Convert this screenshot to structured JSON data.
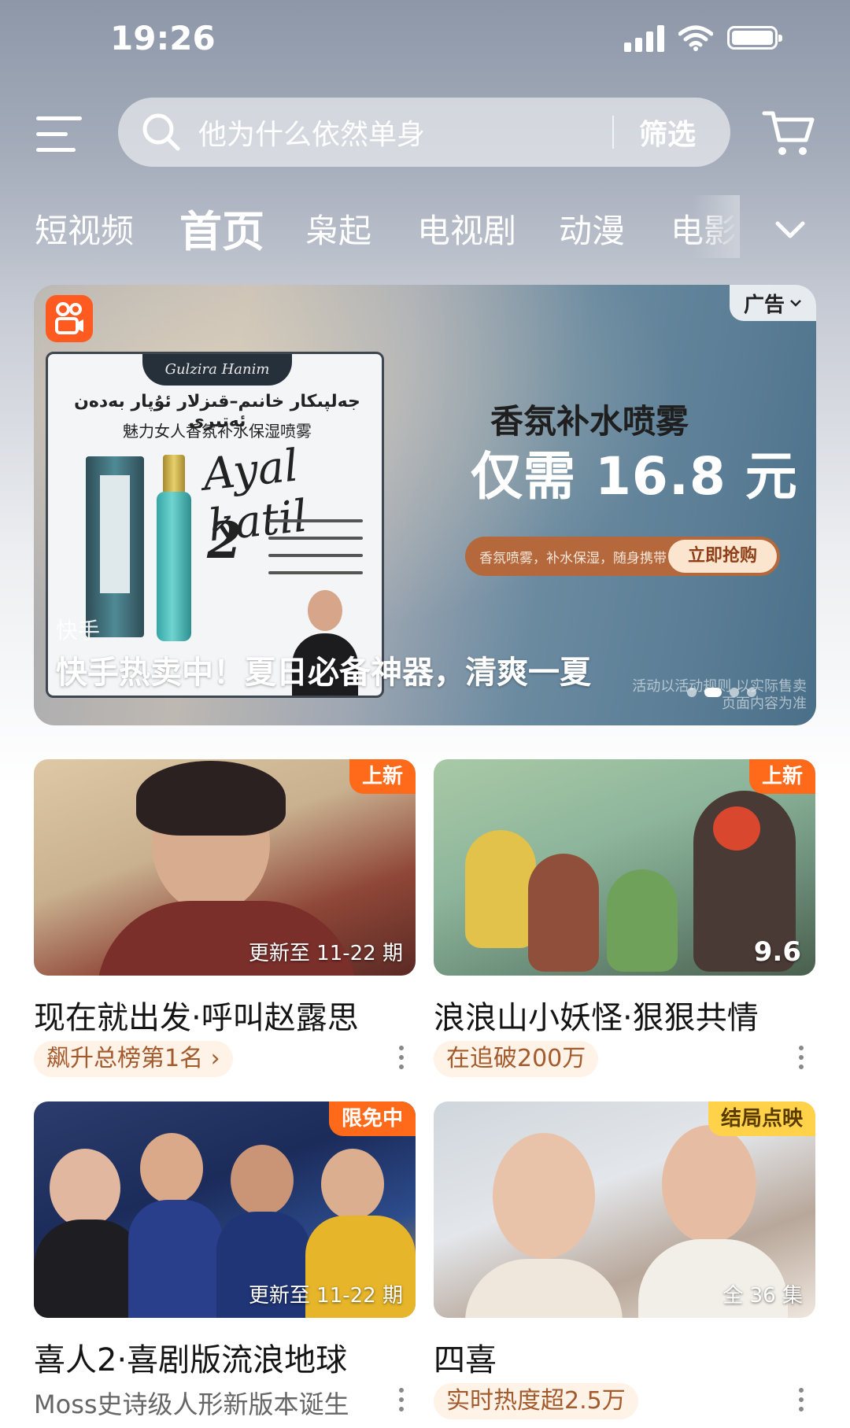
{
  "status_bar": {
    "time": "19:26"
  },
  "search": {
    "placeholder": "他为什么依然单身",
    "filter_label": "筛选"
  },
  "tabs": [
    {
      "label": "短视频"
    },
    {
      "label": "首页",
      "active": true
    },
    {
      "label": "枭起"
    },
    {
      "label": "电视剧"
    },
    {
      "label": "动漫"
    },
    {
      "label": "电影"
    }
  ],
  "banner": {
    "ad_label": "广告",
    "product_brand": "Gulzira Hanim",
    "product_uyghur": "جەلپىكار خانىم–قىزلار ئۇپار بەدەن ئەتىرى",
    "product_cn": "魅力女人香氛补水保湿喷雾",
    "product_script": "Ayal katil",
    "product_number": "2",
    "headline": "香氛补水喷雾",
    "price": "仅需 16.8 元",
    "pill_text": "香氛喷雾，补水保湿，随身携带！",
    "buy_label": "立即抢购",
    "source": "快手",
    "caption": "快手热卖中！夏日必备神器，清爽一夏",
    "disclaimer": "活动以活动规则 以实际售卖页面内容为准"
  },
  "cards": [
    {
      "title": "现在就出发·呼叫赵露思",
      "badge": "上新",
      "thumb_label": "更新至 11-22 期",
      "sub": "飙升总榜第1名 ›"
    },
    {
      "title": "浪浪山小妖怪·狠狠共情",
      "badge": "上新",
      "score": "9.6",
      "sub": "在追破200万"
    },
    {
      "title": "喜人2·喜剧版流浪地球",
      "badge": "限免中",
      "thumb_label": "更新至 11-22 期",
      "sub": "Moss史诗级人形新版本诞生"
    },
    {
      "title": "四喜",
      "badge": "结局点映",
      "thumb_label": "全 36 集",
      "sub": "实时热度超2.5万"
    }
  ],
  "colors": {
    "accent_orange": "#ff6a1a",
    "badge_yellow": "#ffd24a",
    "sub_tag_bg": "#fff2e6",
    "sub_tag_text": "#a35a2c"
  }
}
